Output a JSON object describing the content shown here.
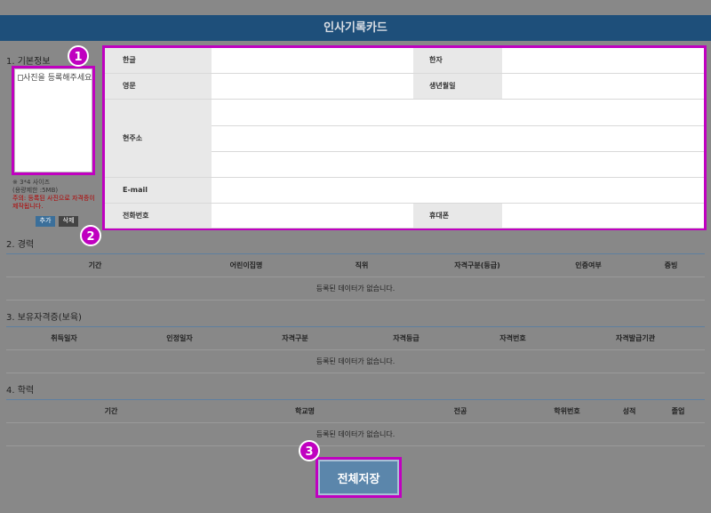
{
  "header": {
    "title": "인사기록카드"
  },
  "sections": {
    "basic": "1. 기본정보",
    "career": "2. 경력",
    "certs": "3. 보유자격증(보육)",
    "education": "4. 학력"
  },
  "photo": {
    "placeholder": "사진을 등록해주세요",
    "note1": "※ 3*4 사이즈",
    "note2": "(용량제한 :5MB)",
    "note3": "주의: 등록된 사진으로 자격증이 제작됩니다.",
    "add_label": "추가",
    "delete_label": "삭제"
  },
  "info": {
    "korean": "한글",
    "hanja": "한자",
    "english": "영문",
    "birth": "생년월일",
    "address": "현주소",
    "email": "E-mail",
    "phone": "전화번호",
    "mobile": "휴대폰"
  },
  "career_table": {
    "headers": [
      "기간",
      "어린이집명",
      "직위",
      "자격구분(등급)",
      "인증여부",
      "증빙"
    ],
    "empty": "등록된 데이터가 없습니다."
  },
  "cert_table": {
    "headers": [
      "취득일자",
      "인정일자",
      "자격구분",
      "자격등급",
      "자격번호",
      "자격발급기관"
    ],
    "empty": "등록된 데이터가 없습니다."
  },
  "edu_table": {
    "headers": [
      "기간",
      "학교명",
      "전공",
      "학위번호",
      "성적",
      "졸업"
    ],
    "empty": "등록된 데이터가 없습니다."
  },
  "save_label": "전체저장",
  "badges": [
    "1",
    "2",
    "3"
  ],
  "colors": {
    "header": "#1e4f7a",
    "highlight": "#c000c0",
    "save": "#5b86ab"
  }
}
